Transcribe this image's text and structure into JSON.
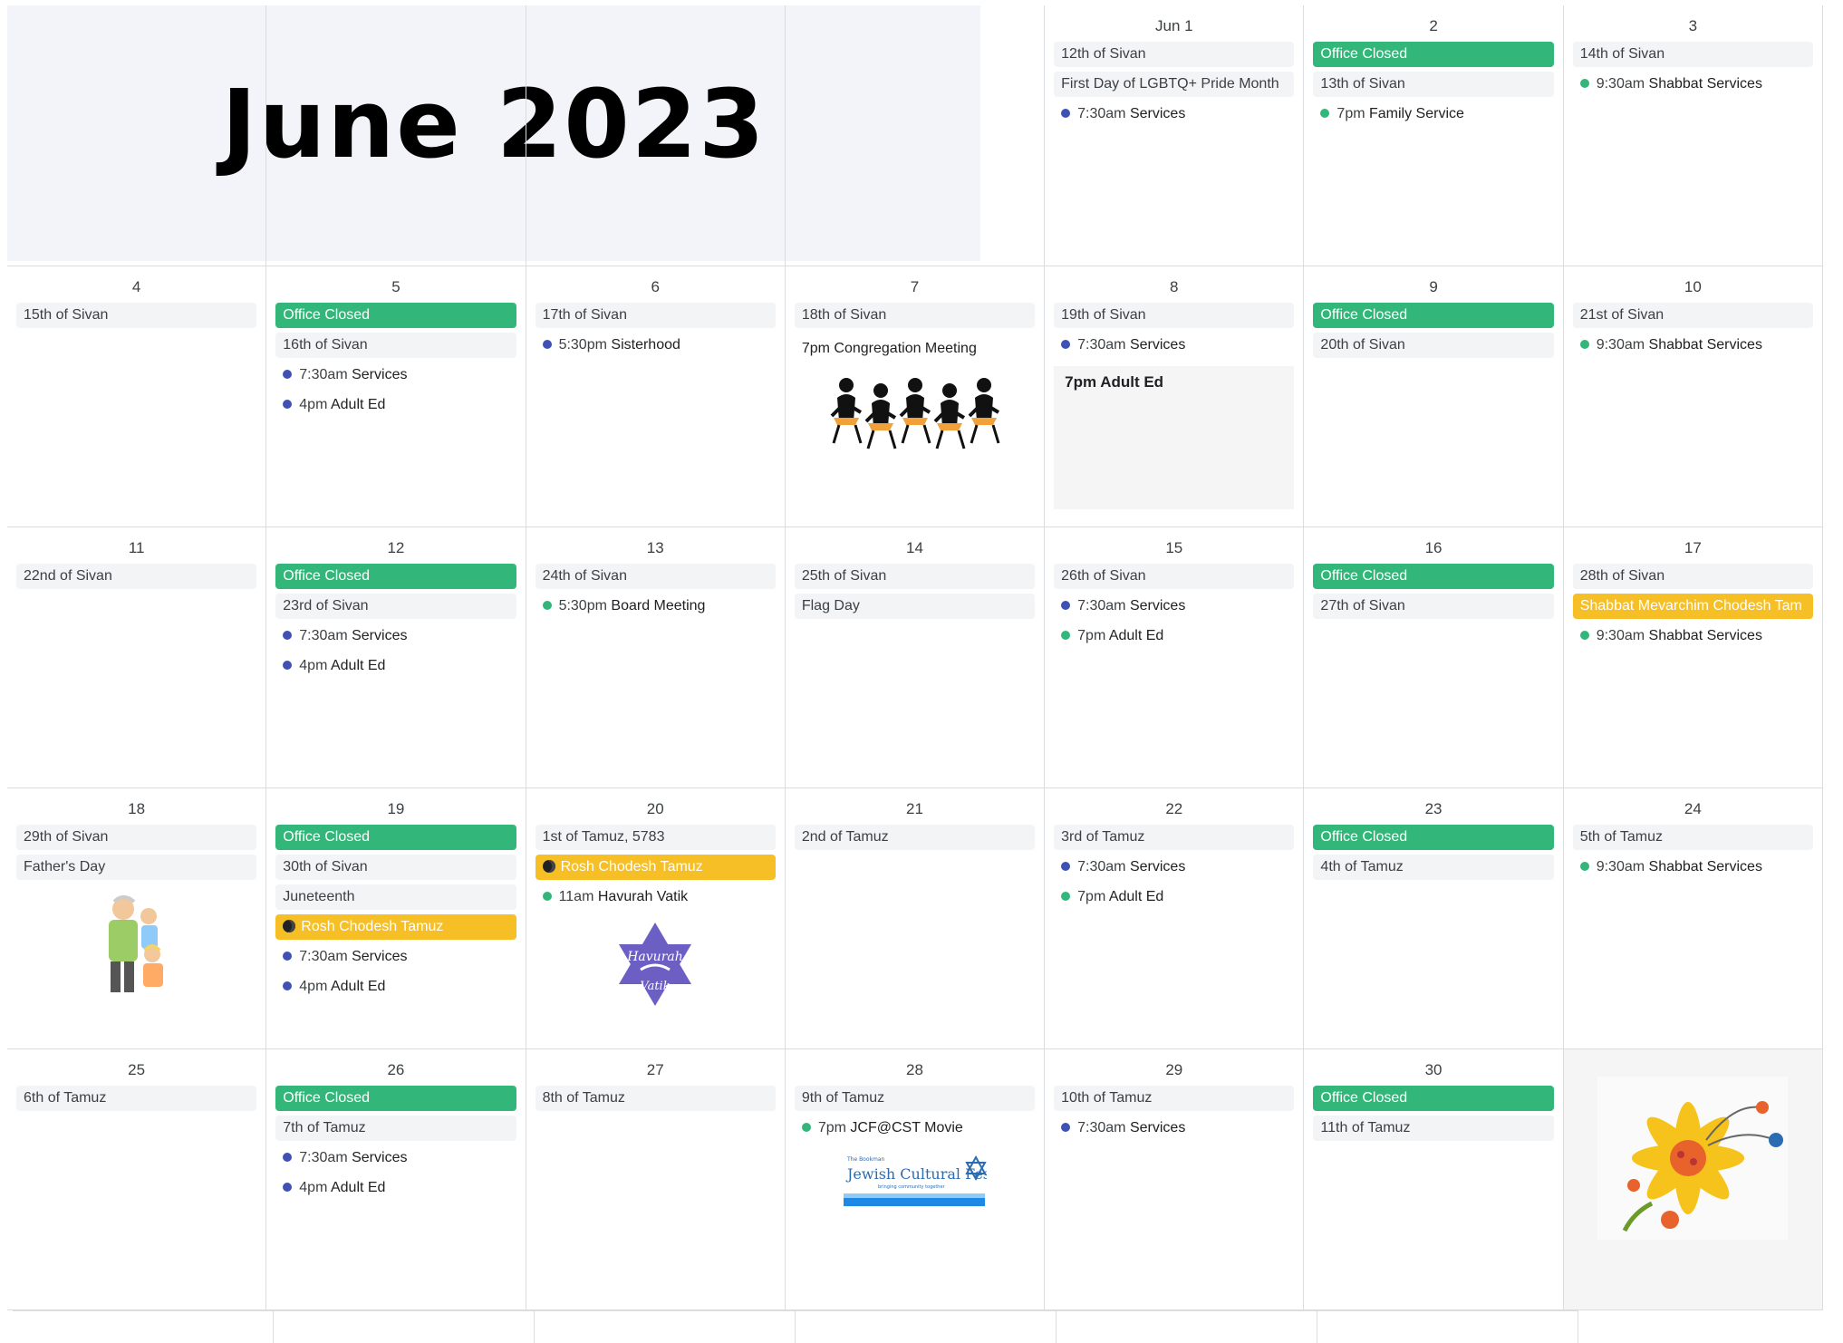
{
  "calendar": {
    "title": "June 2023",
    "colors": {
      "office_closed": "#33b679",
      "holiday": "#f6bf26",
      "dot_blue": "#3f51b5",
      "dot_green": "#33b679"
    },
    "weeks": [
      [
        {
          "day": "",
          "items": []
        },
        {
          "day": "",
          "items": []
        },
        {
          "day": "",
          "items": []
        },
        {
          "day": "",
          "items": []
        },
        {
          "day": "Jun 1",
          "items": [
            {
              "kind": "plain",
              "text": "12th of Sivan"
            },
            {
              "kind": "plain",
              "text": "First Day of LGBTQ+ Pride Month"
            },
            {
              "kind": "event",
              "dot": "blue",
              "time": "7:30am",
              "text": "Services"
            }
          ]
        },
        {
          "day": "2",
          "items": [
            {
              "kind": "green",
              "text": "Office Closed"
            },
            {
              "kind": "plain",
              "text": "13th of Sivan"
            },
            {
              "kind": "event",
              "dot": "green",
              "time": "7pm",
              "text": "Family Service"
            }
          ]
        },
        {
          "day": "3",
          "items": [
            {
              "kind": "plain",
              "text": "14th of Sivan"
            },
            {
              "kind": "event",
              "dot": "green",
              "time": "9:30am",
              "text": "Shabbat Services"
            }
          ]
        }
      ],
      [
        {
          "day": "4",
          "items": [
            {
              "kind": "plain",
              "text": "15th of Sivan"
            }
          ]
        },
        {
          "day": "5",
          "items": [
            {
              "kind": "green",
              "text": "Office Closed"
            },
            {
              "kind": "plain",
              "text": "16th of Sivan"
            },
            {
              "kind": "event",
              "dot": "blue",
              "time": "7:30am",
              "text": "Services"
            },
            {
              "kind": "event",
              "dot": "blue",
              "time": "4pm",
              "text": "Adult Ed"
            }
          ]
        },
        {
          "day": "6",
          "items": [
            {
              "kind": "plain",
              "text": "17th of Sivan"
            },
            {
              "kind": "event",
              "dot": "blue",
              "time": "5:30pm",
              "text": "Sisterhood"
            }
          ]
        },
        {
          "day": "7",
          "items": [
            {
              "kind": "plain",
              "text": "18th of Sivan"
            },
            {
              "kind": "note",
              "text": "7pm Congregation Meeting"
            }
          ],
          "picture": "meeting"
        },
        {
          "day": "8",
          "items": [
            {
              "kind": "plain",
              "text": "19th of Sivan"
            },
            {
              "kind": "event",
              "dot": "blue",
              "time": "7:30am",
              "text": "Services"
            },
            {
              "kind": "box",
              "text": "7pm Adult Ed"
            }
          ]
        },
        {
          "day": "9",
          "items": [
            {
              "kind": "green",
              "text": "Office Closed"
            },
            {
              "kind": "plain",
              "text": "20th of Sivan"
            }
          ]
        },
        {
          "day": "10",
          "items": [
            {
              "kind": "plain",
              "text": "21st of Sivan"
            },
            {
              "kind": "event",
              "dot": "green",
              "time": "9:30am",
              "text": "Shabbat Services"
            }
          ]
        }
      ],
      [
        {
          "day": "11",
          "items": [
            {
              "kind": "plain",
              "text": "22nd of Sivan"
            }
          ]
        },
        {
          "day": "12",
          "items": [
            {
              "kind": "green",
              "text": "Office Closed"
            },
            {
              "kind": "plain",
              "text": "23rd of Sivan"
            },
            {
              "kind": "event",
              "dot": "blue",
              "time": "7:30am",
              "text": "Services"
            },
            {
              "kind": "event",
              "dot": "blue",
              "time": "4pm",
              "text": "Adult Ed"
            }
          ]
        },
        {
          "day": "13",
          "items": [
            {
              "kind": "plain",
              "text": "24th of Sivan"
            },
            {
              "kind": "event",
              "dot": "green",
              "time": "5:30pm",
              "text": "Board Meeting"
            }
          ]
        },
        {
          "day": "14",
          "items": [
            {
              "kind": "plain",
              "text": "25th of Sivan"
            },
            {
              "kind": "plain",
              "text": "Flag Day"
            }
          ]
        },
        {
          "day": "15",
          "items": [
            {
              "kind": "plain",
              "text": "26th of Sivan"
            },
            {
              "kind": "event",
              "dot": "blue",
              "time": "7:30am",
              "text": "Services"
            },
            {
              "kind": "event",
              "dot": "green",
              "time": "7pm",
              "text": "Adult Ed"
            }
          ]
        },
        {
          "day": "16",
          "items": [
            {
              "kind": "green",
              "text": "Office Closed"
            },
            {
              "kind": "plain",
              "text": "27th of Sivan"
            }
          ]
        },
        {
          "day": "17",
          "items": [
            {
              "kind": "plain",
              "text": "28th of Sivan"
            },
            {
              "kind": "yellow",
              "text": "Shabbat Mevarchim Chodesh Tam"
            },
            {
              "kind": "event",
              "dot": "green",
              "time": "9:30am",
              "text": "Shabbat Services"
            }
          ]
        }
      ],
      [
        {
          "day": "18",
          "items": [
            {
              "kind": "plain",
              "text": "29th of Sivan"
            },
            {
              "kind": "plain",
              "text": "Father's Day"
            }
          ],
          "picture": "family"
        },
        {
          "day": "19",
          "items": [
            {
              "kind": "green",
              "text": "Office Closed"
            },
            {
              "kind": "plain",
              "text": "30th of Sivan"
            },
            {
              "kind": "plain",
              "text": "Juneteenth"
            },
            {
              "kind": "yellow",
              "text": "Rosh Chodesh Tamuz",
              "moon": true
            },
            {
              "kind": "event",
              "dot": "blue",
              "time": "7:30am",
              "text": "Services"
            },
            {
              "kind": "event",
              "dot": "blue",
              "time": "4pm",
              "text": "Adult Ed"
            }
          ]
        },
        {
          "day": "20",
          "items": [
            {
              "kind": "plain",
              "text": "1st of Tamuz, 5783"
            },
            {
              "kind": "yellow",
              "text": "Rosh Chodesh Tamuz",
              "moon": true
            },
            {
              "kind": "event",
              "dot": "green",
              "time": "11am",
              "text": "Havurah Vatik"
            }
          ],
          "picture": "havurah"
        },
        {
          "day": "21",
          "items": [
            {
              "kind": "plain",
              "text": "2nd of Tamuz"
            }
          ]
        },
        {
          "day": "22",
          "items": [
            {
              "kind": "plain",
              "text": "3rd of Tamuz"
            },
            {
              "kind": "event",
              "dot": "blue",
              "time": "7:30am",
              "text": "Services"
            },
            {
              "kind": "event",
              "dot": "green",
              "time": "7pm",
              "text": "Adult Ed"
            }
          ]
        },
        {
          "day": "23",
          "items": [
            {
              "kind": "green",
              "text": "Office Closed"
            },
            {
              "kind": "plain",
              "text": "4th of Tamuz"
            }
          ]
        },
        {
          "day": "24",
          "items": [
            {
              "kind": "plain",
              "text": "5th of Tamuz"
            },
            {
              "kind": "event",
              "dot": "green",
              "time": "9:30am",
              "text": "Shabbat Services"
            }
          ]
        }
      ],
      [
        {
          "day": "25",
          "items": [
            {
              "kind": "plain",
              "text": "6th of Tamuz"
            }
          ]
        },
        {
          "day": "26",
          "items": [
            {
              "kind": "green",
              "text": "Office Closed"
            },
            {
              "kind": "plain",
              "text": "7th of Tamuz"
            },
            {
              "kind": "event",
              "dot": "blue",
              "time": "7:30am",
              "text": "Services"
            },
            {
              "kind": "event",
              "dot": "blue",
              "time": "4pm",
              "text": "Adult Ed"
            }
          ]
        },
        {
          "day": "27",
          "items": [
            {
              "kind": "plain",
              "text": "8th of Tamuz"
            }
          ]
        },
        {
          "day": "28",
          "items": [
            {
              "kind": "plain",
              "text": "9th of Tamuz"
            },
            {
              "kind": "event",
              "dot": "green",
              "time": "7pm",
              "text": "JCF@CST Movie"
            }
          ],
          "picture": "festival"
        },
        {
          "day": "29",
          "items": [
            {
              "kind": "plain",
              "text": "10th of Tamuz"
            },
            {
              "kind": "event",
              "dot": "blue",
              "time": "7:30am",
              "text": "Services"
            }
          ]
        },
        {
          "day": "30",
          "items": [
            {
              "kind": "green",
              "text": "Office Closed"
            },
            {
              "kind": "plain",
              "text": "11th of Tamuz"
            }
          ]
        },
        {
          "day": "",
          "items": [],
          "picture": "flower"
        }
      ]
    ],
    "festival_logo": {
      "line1": "The Bookman",
      "line2": "Jewish Cultural Festival",
      "line3": "bringing community together"
    },
    "havurah_logo": {
      "top": "Havurah",
      "bottom": "Vatik"
    }
  }
}
